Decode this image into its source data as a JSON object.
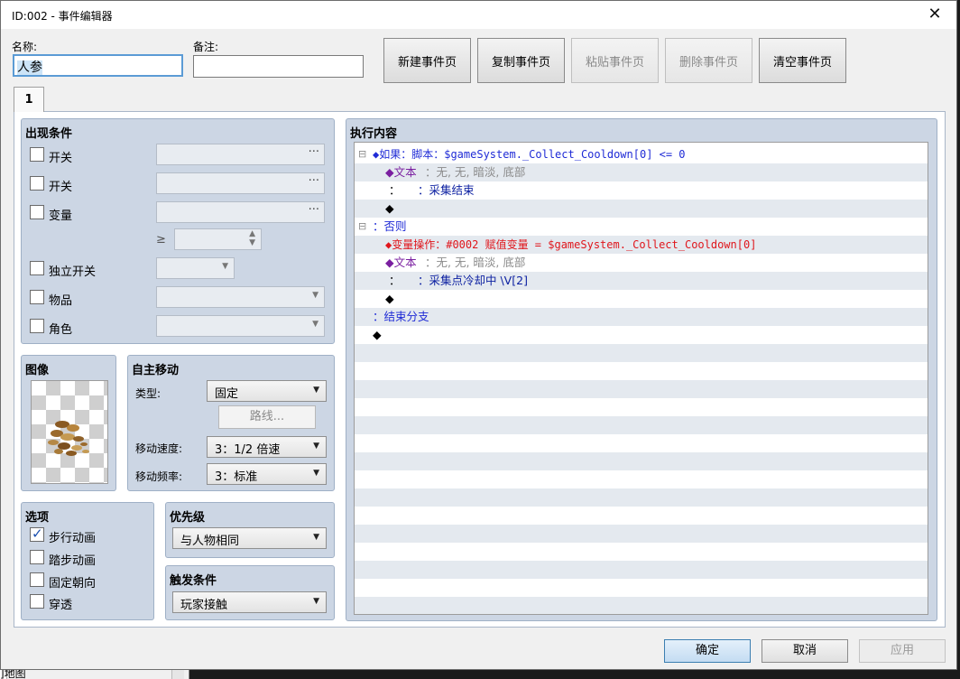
{
  "window": {
    "title": "ID:002 - 事件编辑器",
    "close_glyph": "✕"
  },
  "background": {
    "tail_text": "]地图"
  },
  "header": {
    "name_label": "名称:",
    "name_value": "人参",
    "note_label": "备注:",
    "note_value": "",
    "buttons": [
      "新建事件页",
      "复制事件页",
      "粘贴事件页",
      "删除事件页",
      "清空事件页"
    ]
  },
  "tabs": [
    {
      "label": "1"
    }
  ],
  "conditions": {
    "title": "出现条件",
    "switch1": "开关",
    "switch2": "开关",
    "variable": "变量",
    "gte": "≥",
    "self_switch": "独立开关",
    "item": "物品",
    "actor": "角色",
    "dots": "···"
  },
  "image": {
    "title": "图像"
  },
  "movement": {
    "title": "自主移动",
    "type_label": "类型:",
    "type_value": "固定",
    "route_button": "路线...",
    "speed_label": "移动速度:",
    "speed_value": "3：1/2 倍速",
    "freq_label": "移动频率:",
    "freq_value": "3：标准"
  },
  "options": {
    "title": "选项",
    "walking": "步行动画",
    "stepping": "踏步动画",
    "direction_fix": "固定朝向",
    "through": "穿透"
  },
  "priority": {
    "title": "优先级",
    "value": "与人物相同"
  },
  "trigger": {
    "title": "触发条件",
    "value": "玩家接触"
  },
  "contents": {
    "title": "执行内容",
    "lines": {
      "l0a": "⊟",
      "l0b": "◆如果：脚本：$gameSystem._Collect_Cooldown[0] <= 0",
      "l1a": "◆文本",
      "l1b": "：无, 无, 暗淡, 底部",
      "l2a": "：",
      "l2b": "：采集结束",
      "l3": "◆",
      "l4a": "⊟",
      "l4b": "：否则",
      "l5": "◆变量操作：#0002 赋值变量 = $gameSystem._Collect_Cooldown[0]",
      "l6a": "◆文本",
      "l6b": "：无, 无, 暗淡, 底部",
      "l7a": "：",
      "l7b": "：采集点冷却中 \\V[2]",
      "l8": "◆",
      "l9": "：结束分支",
      "l10": "◆"
    }
  },
  "footer": {
    "ok": "确定",
    "cancel": "取消",
    "apply": "应用"
  }
}
